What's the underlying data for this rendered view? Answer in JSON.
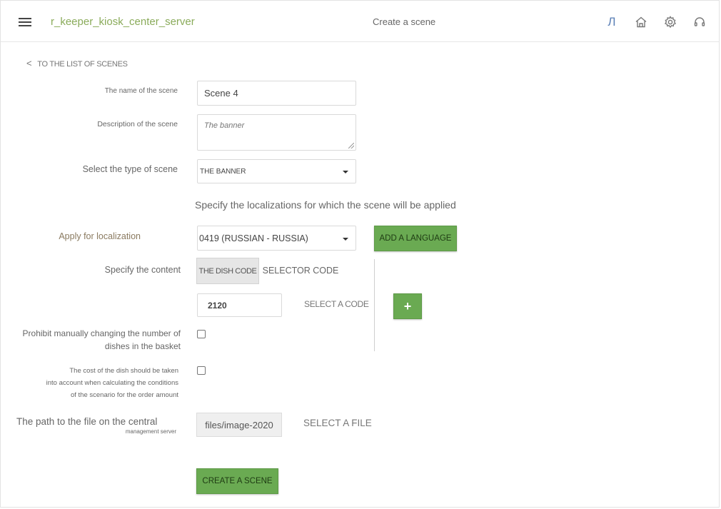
{
  "header": {
    "app_title": "r_keeper_kiosk_center_server",
    "page_title": "Create a scene",
    "lang_icon_glyph": "Л"
  },
  "back_link": {
    "label": "TO THE LIST OF SCENES"
  },
  "form": {
    "scene_name": {
      "label": "The name of the scene",
      "value": "Scene 4"
    },
    "description": {
      "label": "Description of the scene",
      "value": "The banner"
    },
    "scene_type": {
      "label": "Select the type of scene",
      "value": "THE BANNER"
    },
    "localization_heading": "Specify the localizations for which the scene will be applied",
    "localization": {
      "label": "Apply for localization",
      "value": "0419 (RUSSIAN - RUSSIA)",
      "add_button": "ADD A LANGUAGE"
    },
    "content": {
      "label": "Specify the content",
      "tabs": [
        {
          "label": "THE DISH CODE",
          "active": true
        },
        {
          "label": "SELECTOR CODE",
          "active": false
        }
      ],
      "code_value": "2120",
      "select_code_link": "SELECT A CODE",
      "add_symbol": "+"
    },
    "prohibit_change": {
      "label_line1": "Prohibit manually changing the number of",
      "label_line2": "dishes in the basket",
      "checked": false
    },
    "cost_in_conditions": {
      "label_line1": "The cost of the dish should be taken",
      "label_line2": "into account when calculating the conditions",
      "label_line3": "of the scenario for the order amount",
      "checked": false
    },
    "file_path": {
      "label_line1": "The path to the file on the central",
      "label_line2": "management server",
      "value": "files/image-2020",
      "select_file_link": "SELECT A FILE"
    },
    "submit_button": "CREATE A SCENE"
  },
  "colors": {
    "accent_green": "#6aaa52",
    "app_title_green": "#8aab5a",
    "lang_blue": "#5a7fb6"
  },
  "icons": {
    "menu": "hamburger-menu-icon",
    "language": "language-icon",
    "home": "home-icon",
    "settings": "gear-icon",
    "support": "headset-icon",
    "back": "chevron-left-icon",
    "add": "plus-icon"
  }
}
